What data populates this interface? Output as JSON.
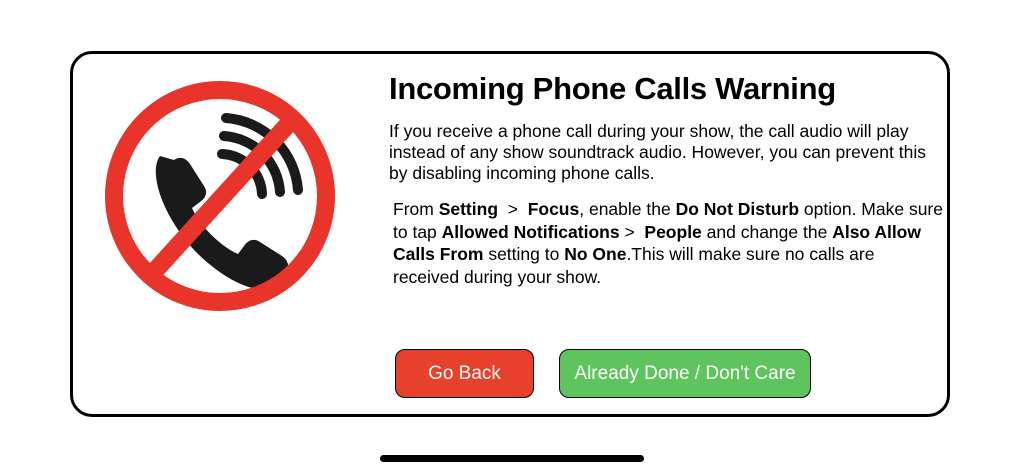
{
  "dialog": {
    "title": "Incoming Phone Calls Warning",
    "intro": "If you receive a phone call during your show, the call audio will play instead of any show soundtrack audio. However, you can prevent this by disabling incoming phone calls.",
    "instructions": {
      "t1": "From ",
      "b1": "Setting",
      "t2": "  >  ",
      "b2": "Focus",
      "t3": ", enable the ",
      "b3": "Do Not Disturb",
      "t4": " option. Make sure to tap ",
      "b4": "Allowed Notifications",
      "t5": " >  ",
      "b5": "People",
      "t6": " and change the ",
      "b6": "Also Allow Calls From",
      "t7": " setting to ",
      "b7": "No One",
      "t8": ".This will make sure no calls are received during your show."
    },
    "buttons": {
      "back_label": "Go Back",
      "done_label": "Already Done / Don't Care"
    }
  },
  "icons": {
    "warning_image": "no-phone-calls-icon"
  },
  "colors": {
    "prohibition_red": "#e8342a",
    "back_button": "#e8412b",
    "done_button": "#5fc35e"
  }
}
